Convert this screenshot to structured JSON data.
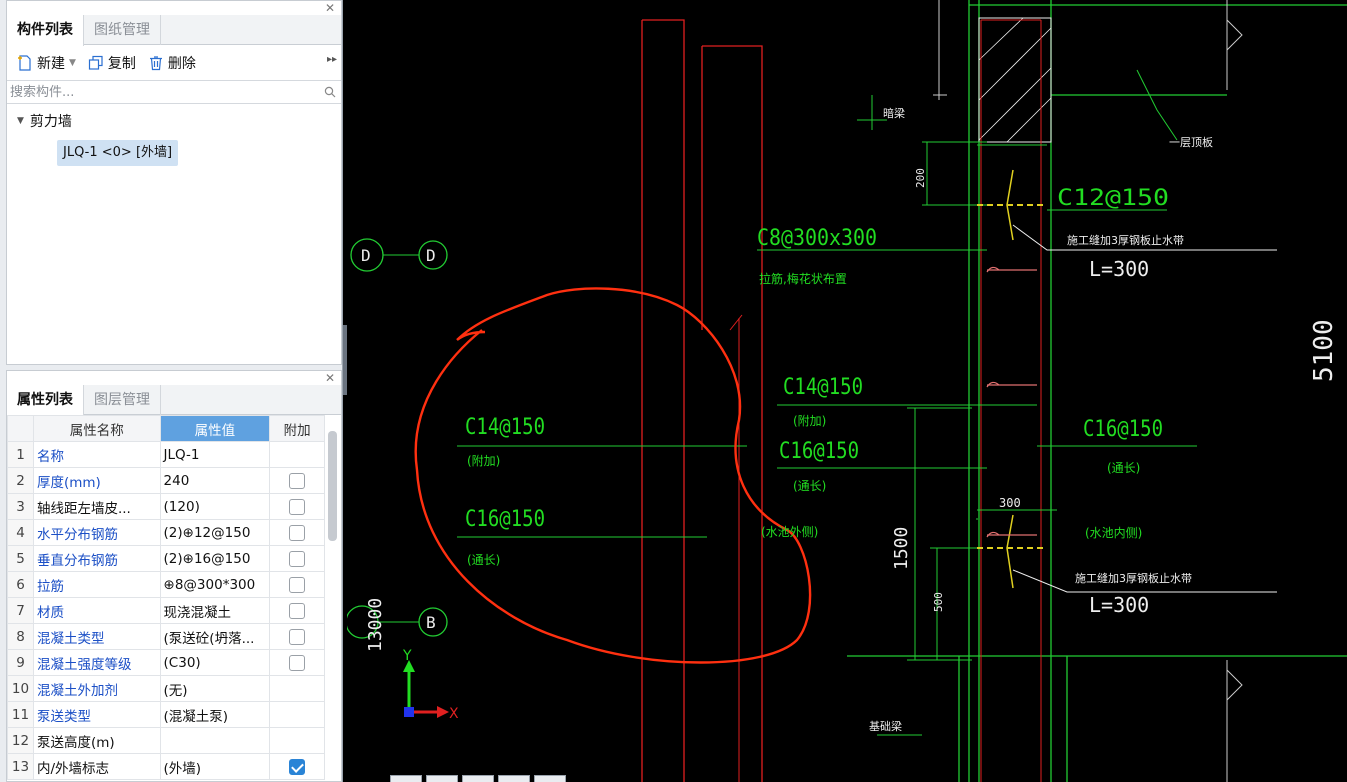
{
  "component_panel": {
    "tabs": [
      {
        "label": "构件列表",
        "active": true
      },
      {
        "label": "图纸管理",
        "active": false
      }
    ],
    "toolbar": {
      "new_label": "新建",
      "copy_label": "复制",
      "delete_label": "删除"
    },
    "search": {
      "placeholder": "搜索构件..."
    },
    "tree": {
      "group_label": "剪力墙",
      "item_label": "JLQ-1 <0> [外墙]"
    }
  },
  "property_panel": {
    "tabs": [
      {
        "label": "属性列表",
        "active": true
      },
      {
        "label": "图层管理",
        "active": false
      }
    ],
    "columns": {
      "name": "属性名称",
      "value": "属性值",
      "extra": "附加"
    },
    "rows": [
      {
        "idx": "1",
        "name": "名称",
        "value": "JLQ-1",
        "link": true,
        "checkbox": "none"
      },
      {
        "idx": "2",
        "name": "厚度(mm)",
        "value": "240",
        "link": true,
        "checkbox": "off"
      },
      {
        "idx": "3",
        "name": "轴线距左墙皮...",
        "value": "(120)",
        "link": false,
        "checkbox": "off"
      },
      {
        "idx": "4",
        "name": "水平分布钢筋",
        "value": "(2)⊕12@150",
        "link": true,
        "checkbox": "off"
      },
      {
        "idx": "5",
        "name": "垂直分布钢筋",
        "value": "(2)⊕16@150",
        "link": true,
        "checkbox": "off"
      },
      {
        "idx": "6",
        "name": "拉筋",
        "value": "⊕8@300*300",
        "link": true,
        "checkbox": "off"
      },
      {
        "idx": "7",
        "name": "材质",
        "value": "现浇混凝土",
        "link": true,
        "checkbox": "off"
      },
      {
        "idx": "8",
        "name": "混凝土类型",
        "value": "(泵送砼(坍落...",
        "link": true,
        "checkbox": "off"
      },
      {
        "idx": "9",
        "name": "混凝土强度等级",
        "value": "(C30)",
        "link": true,
        "checkbox": "off"
      },
      {
        "idx": "10",
        "name": "混凝土外加剂",
        "value": "(无)",
        "link": true,
        "checkbox": "none"
      },
      {
        "idx": "11",
        "name": "泵送类型",
        "value": "(混凝土泵)",
        "link": true,
        "checkbox": "none"
      },
      {
        "idx": "12",
        "name": "泵送高度(m)",
        "value": "",
        "link": false,
        "checkbox": "none"
      },
      {
        "idx": "13",
        "name": "内/外墙标志",
        "value": "(外墙)",
        "link": false,
        "checkbox": "on"
      }
    ]
  },
  "drawing": {
    "axis_d": "D",
    "axis_b": "B",
    "dim_13000": "13000",
    "dim_5100": "5100",
    "dim_200": "200",
    "dim_300": "300",
    "dim_1500": "1500",
    "dim_500": "500",
    "label_c12": "C12@150",
    "label_c8": "C8@300x300",
    "label_c8_note": "拉筋,梅花状布置",
    "label_c14_a": "C14@150",
    "label_fujia_a": "(附加)",
    "label_c16_a": "C16@150",
    "label_tongchang_a": "(通长)",
    "label_c14_b": "C14@150",
    "label_fujia_b": "(附加)",
    "label_c16_b": "C16@150",
    "label_tongchang_b": "(通长)",
    "label_c16_c": "C16@150",
    "label_tongchang_c": "(通长)",
    "label_outside": "(水池外侧)",
    "label_inside": "(水池内侧)",
    "label_waterstop_1": "施工缝加3厚钢板止水带",
    "label_l300_1": "L=300",
    "label_waterstop_2": "施工缝加3厚钢板止水带",
    "label_l300_2": "L=300",
    "label_anliang": "暗梁",
    "label_slab": "一层顶板",
    "label_jichu": "基础梁",
    "ucs_x": "X",
    "ucs_y": "Y"
  }
}
